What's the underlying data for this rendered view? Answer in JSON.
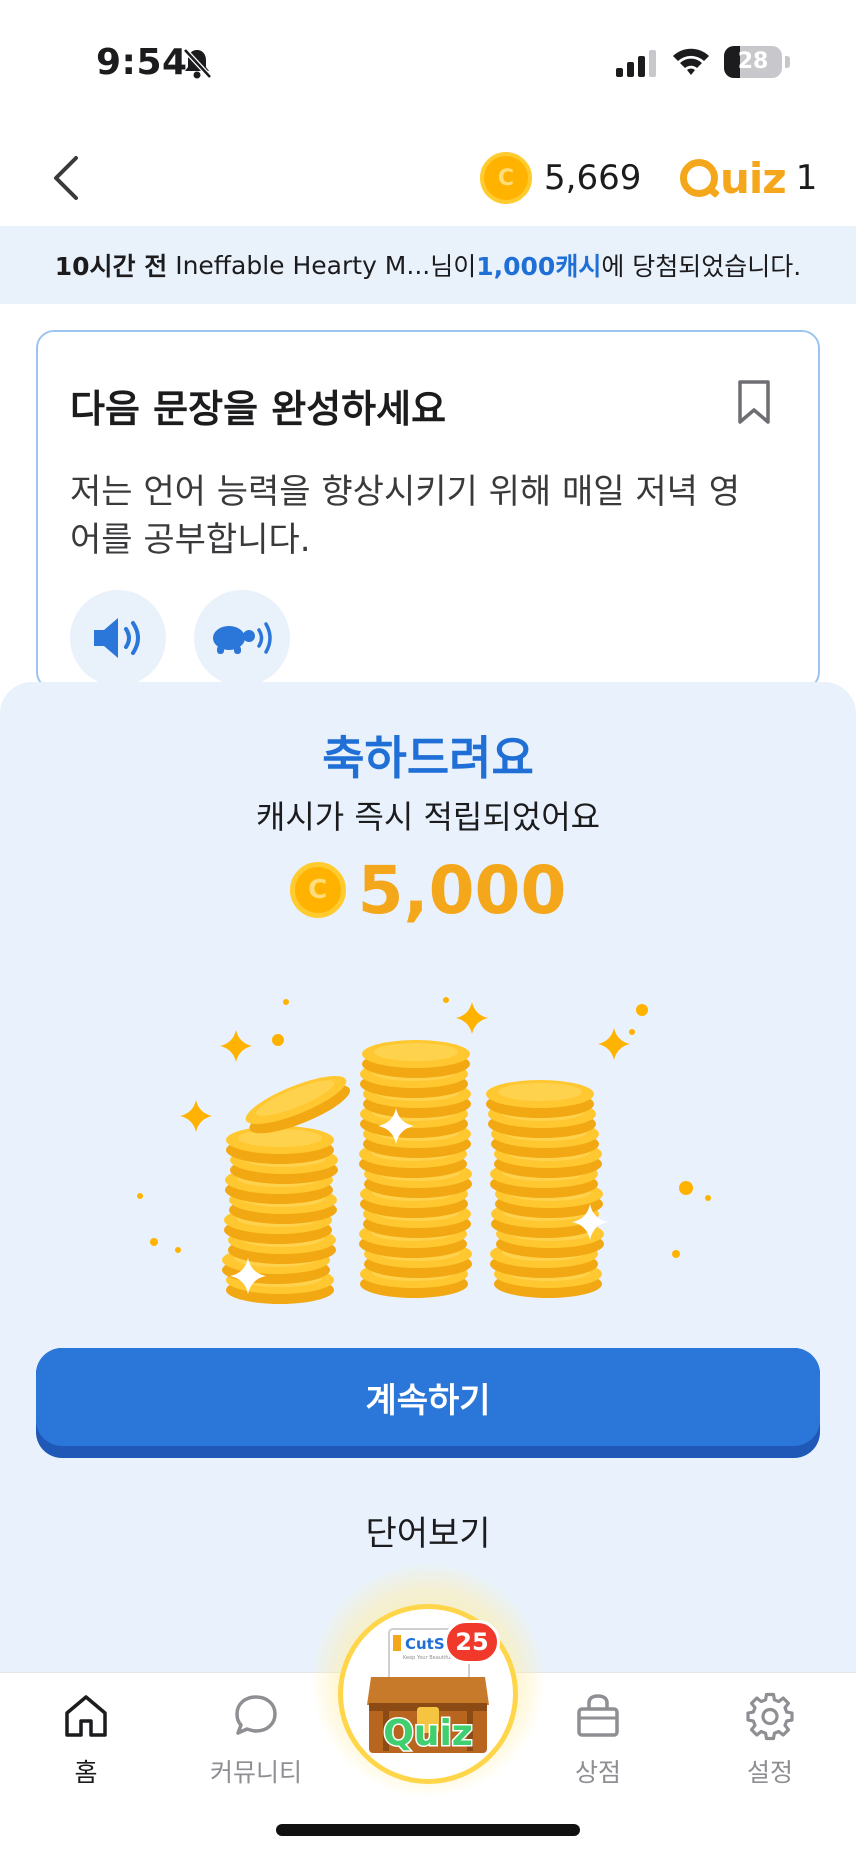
{
  "status_bar": {
    "time": "9:54",
    "battery": "28",
    "battery_level": 0.28
  },
  "header": {
    "back_icon": "chevron-left-icon",
    "coin_symbol": "C",
    "coin_balance": "5,669",
    "quiz_logo_text": "uiz",
    "quiz_count": "1"
  },
  "ticker": {
    "time_ago": "10시간 전",
    "user": "Ineffable Hearty M...",
    "suffix_before": "님이 ",
    "prize": "1,000캐시",
    "suffix_after": "에 당첨되었습니다."
  },
  "question": {
    "title": "다음 문장을 완성하세요",
    "sentence": "저는 언어 능력을 향상시키기 위해 매일 저녁 영어를 공부합니다.",
    "icons": [
      "bookmark-icon",
      "speaker-icon",
      "turtle-slow-speaker-icon"
    ]
  },
  "reward": {
    "title": "축하드려요",
    "subtitle": "캐시가 즉시 적립되었어요",
    "coin_symbol": "C",
    "amount": "5,000",
    "continue_label": "계속하기",
    "word_view_label": "단어보기"
  },
  "tab_bar": {
    "tabs": [
      {
        "label": "홈",
        "icon": "home-icon",
        "active": true
      },
      {
        "label": "커뮤니티",
        "icon": "chat-bubble-icon",
        "active": false
      },
      {
        "label": "상점",
        "icon": "shopping-bag-icon",
        "active": false
      },
      {
        "label": "설정",
        "icon": "gear-icon",
        "active": false
      }
    ],
    "center": {
      "brand": "CutSulin",
      "brand_tagline": "Keep Your Beautiful Body",
      "label": "Quiz",
      "badge": "25"
    }
  },
  "colors": {
    "accent_blue": "#2a76d9",
    "coin_gold": "#f5a71b",
    "sheet_bg": "#e9f2fc",
    "badge_red": "#f0392b"
  }
}
